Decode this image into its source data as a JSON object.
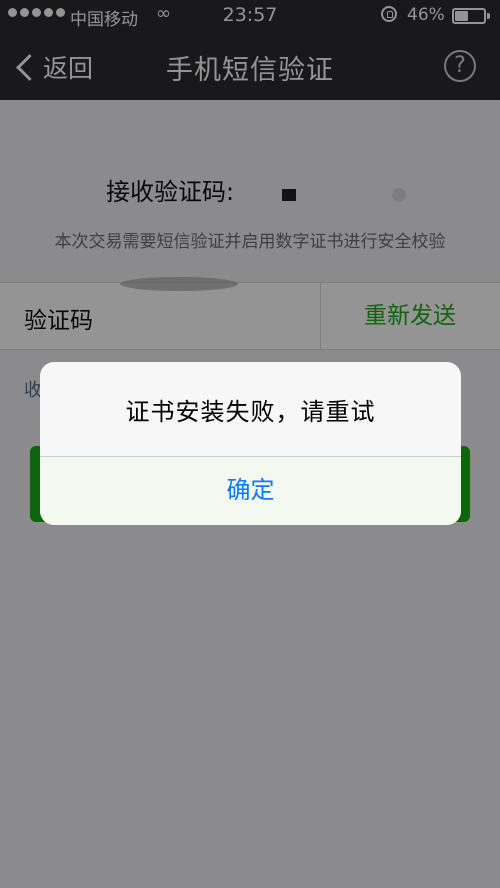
{
  "status_bar": {
    "carrier": "中国移动",
    "time": "23:57",
    "battery_percent": "46%",
    "battery_level": 0.46
  },
  "nav": {
    "back_label": "返回",
    "title": "手机短信验证",
    "help_label": "?"
  },
  "content": {
    "receive_label": "接收验证码:",
    "hint": "本次交易需要短信验证并启用数字证书进行安全校验",
    "code_label": "验证码",
    "resend_label": "重新发送",
    "received_link": "收"
  },
  "alert": {
    "message": "证书安装失败，请重试",
    "ok_label": "确定"
  },
  "colors": {
    "nav_background": "#2b2c30",
    "accent_green": "#1aad19",
    "link_blue": "#0a7aff"
  }
}
